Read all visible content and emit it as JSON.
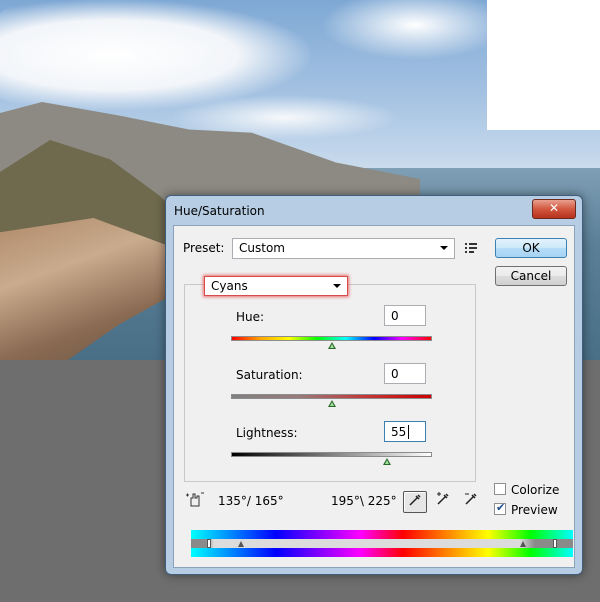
{
  "dialog": {
    "title": "Hue/Saturation",
    "close_label": "✕",
    "preset_label": "Preset:",
    "preset_value": "Custom",
    "ok_label": "OK",
    "cancel_label": "Cancel",
    "channel_value": "Cyans",
    "hue": {
      "label": "Hue:",
      "value": "0",
      "slider_level": 0.5
    },
    "saturation": {
      "label": "Saturation:",
      "value": "0",
      "slider_level": 0.5
    },
    "lightness": {
      "label": "Lightness:",
      "value": "55",
      "slider_level": 0.775
    },
    "range_left": "135°/ 165°",
    "range_right": "195°\\ 225°",
    "colorize_label": "Colorize",
    "colorize_checked": false,
    "preview_label": "Preview",
    "preview_checked": true,
    "icons": {
      "close": "close-icon",
      "preset_options": "preset-options-icon",
      "targeted_adjustment": "hand-adjust-icon",
      "eyedropper": "eyedropper-icon",
      "eyedropper_plus": "eyedropper-plus-icon",
      "eyedropper_minus": "eyedropper-minus-icon"
    }
  }
}
